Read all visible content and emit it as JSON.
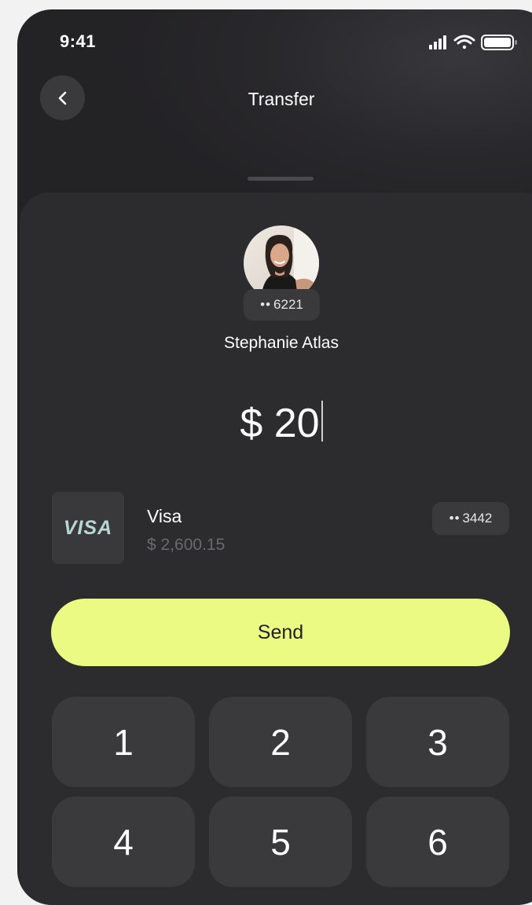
{
  "status_bar": {
    "time": "9:41"
  },
  "header": {
    "title": "Transfer",
    "back_icon": "chevron-left-icon"
  },
  "recipient": {
    "account_masked_dots": "••",
    "account_last4": "6221",
    "name": "Stephanie Atlas"
  },
  "amount": {
    "currency": "$",
    "value": "20",
    "display": "$ 20"
  },
  "card": {
    "logo": "VISA",
    "name": "Visa",
    "balance": "$ 2,600.15",
    "masked_dots": "••",
    "last4": "3442"
  },
  "actions": {
    "send_label": "Send"
  },
  "keypad": {
    "keys": [
      "1",
      "2",
      "3",
      "4",
      "5",
      "6"
    ]
  },
  "colors": {
    "background": "#29282b",
    "sheet": "#2c2b2e",
    "surface": "#3a393c",
    "accent": "#eafa82",
    "visa_logo": "#b9d7d2",
    "muted_text": "#6a696d"
  }
}
